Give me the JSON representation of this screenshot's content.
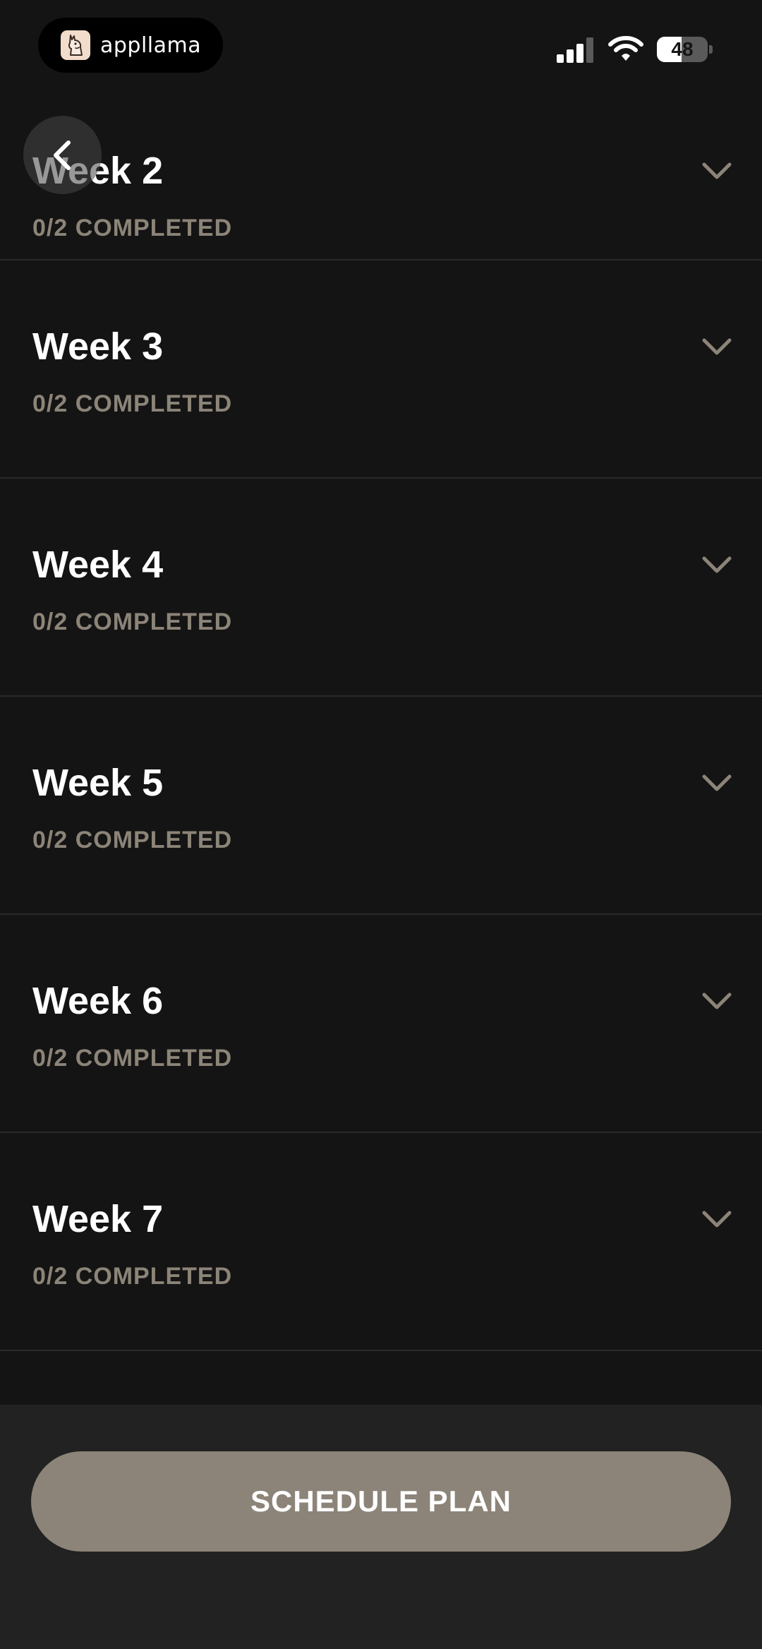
{
  "status_bar": {
    "app_name": "appllama",
    "battery_level": "48",
    "battery_fraction": 0.48,
    "icons": [
      "appllama-logo-icon",
      "signal-icon",
      "wifi-icon",
      "battery-icon"
    ]
  },
  "nav": {
    "back_icon": "chevron-left-icon"
  },
  "weeks": [
    {
      "title": "Week 2",
      "status": "0/2 COMPLETED"
    },
    {
      "title": "Week 3",
      "status": "0/2 COMPLETED"
    },
    {
      "title": "Week 4",
      "status": "0/2 COMPLETED"
    },
    {
      "title": "Week 5",
      "status": "0/2 COMPLETED"
    },
    {
      "title": "Week 6",
      "status": "0/2 COMPLETED"
    },
    {
      "title": "Week 7",
      "status": "0/2 COMPLETED"
    }
  ],
  "footer": {
    "schedule_label": "SCHEDULE PLAN"
  },
  "colors": {
    "background": "#141414",
    "muted_text": "#8c8478",
    "button": "#8c8478",
    "footer": "#222222"
  }
}
